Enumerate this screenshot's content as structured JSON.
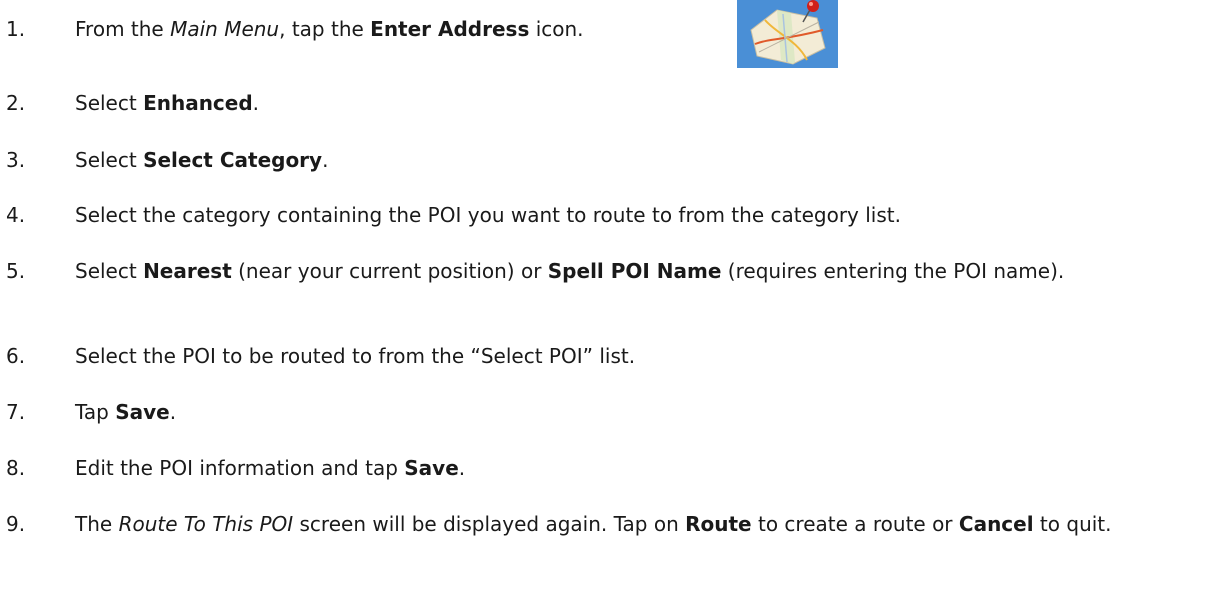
{
  "steps": [
    {
      "number": "1.",
      "parts": [
        {
          "t": "From the ",
          "s": "n"
        },
        {
          "t": "Main Menu",
          "s": "i"
        },
        {
          "t": ", tap the ",
          "s": "n"
        },
        {
          "t": "Enter Address",
          "s": "b"
        },
        {
          "t": " icon.",
          "s": "n"
        }
      ]
    },
    {
      "number": "2.",
      "parts": [
        {
          "t": "Select ",
          "s": "n"
        },
        {
          "t": "Enhanced",
          "s": "b"
        },
        {
          "t": ".",
          "s": "n"
        }
      ]
    },
    {
      "number": "3.",
      "parts": [
        {
          "t": "Select ",
          "s": "n"
        },
        {
          "t": "Select Category",
          "s": "b"
        },
        {
          "t": ".",
          "s": "n"
        }
      ]
    },
    {
      "number": "4.",
      "parts": [
        {
          "t": "Select the category containing the POI you want to route to from the category list.",
          "s": "n"
        }
      ]
    },
    {
      "number": "5.",
      "parts": [
        {
          "t": "Select ",
          "s": "n"
        },
        {
          "t": "Nearest",
          "s": "b"
        },
        {
          "t": " (near your current position) or ",
          "s": "n"
        },
        {
          "t": "Spell POI Name",
          "s": "b"
        },
        {
          "t": " (requires entering the POI name).",
          "s": "n"
        }
      ]
    },
    {
      "number": "6.",
      "parts": [
        {
          "t": "Select the POI to be routed to from the “Select POI” list.",
          "s": "n"
        }
      ]
    },
    {
      "number": "7.",
      "parts": [
        {
          "t": "Tap ",
          "s": "n"
        },
        {
          "t": "Save",
          "s": "b"
        },
        {
          "t": ".",
          "s": "n"
        }
      ]
    },
    {
      "number": "8.",
      "parts": [
        {
          "t": "Edit the POI information and tap ",
          "s": "n"
        },
        {
          "t": "Save",
          "s": "b"
        },
        {
          "t": ".",
          "s": "n"
        }
      ]
    },
    {
      "number": "9.",
      "parts": [
        {
          "t": "The ",
          "s": "n"
        },
        {
          "t": "Route To This POI",
          "s": "i"
        },
        {
          "t": " screen will be displayed again.  Tap on ",
          "s": "n"
        },
        {
          "t": "Route",
          "s": "b"
        },
        {
          "t": " to create a route or ",
          "s": "n"
        },
        {
          "t": "Cancel",
          "s": "b"
        },
        {
          "t": " to quit.",
          "s": "n"
        }
      ]
    }
  ],
  "icons": {
    "enter_address": "map-pin-icon"
  },
  "colors": {
    "icon_sky": "#4a90d9",
    "pin_red": "#d0201a"
  }
}
